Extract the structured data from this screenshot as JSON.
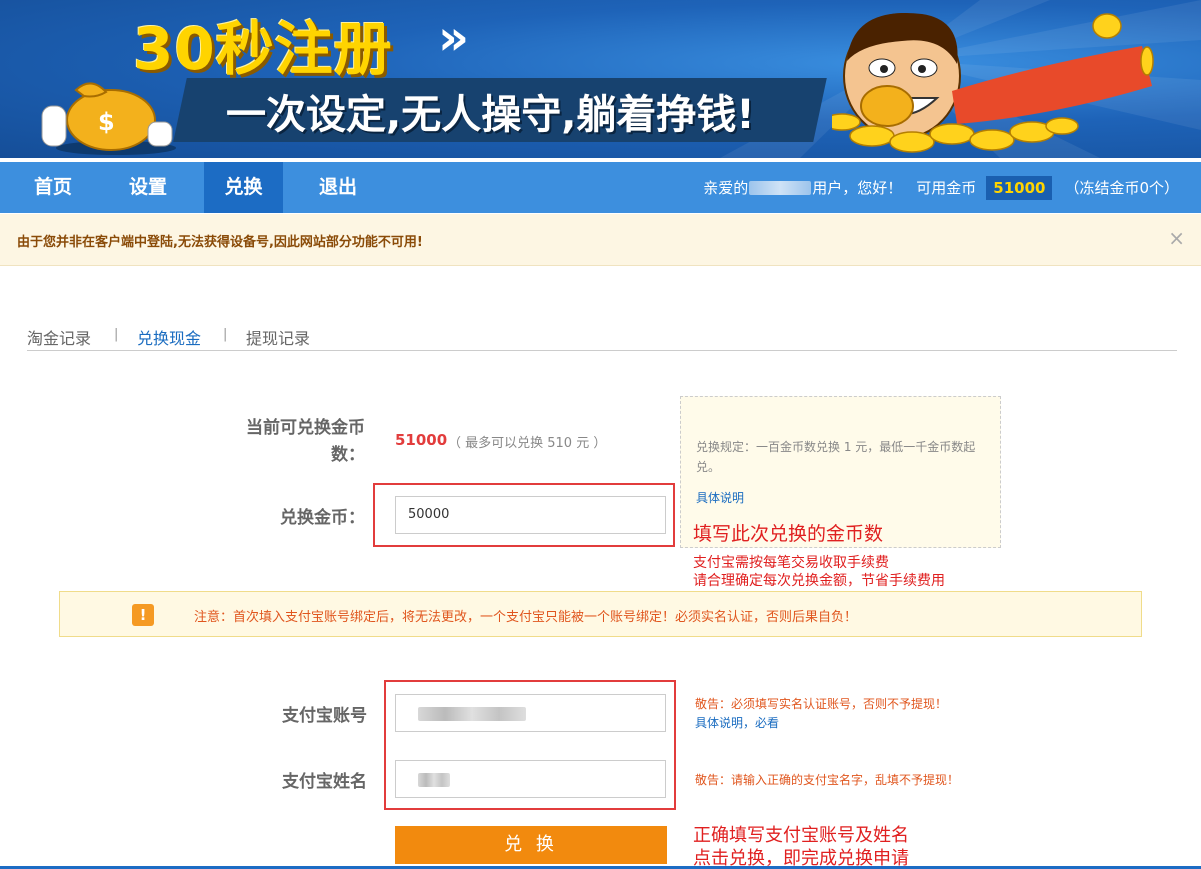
{
  "banner": {
    "title": "30秒注册",
    "chevron": "»",
    "subtitle": "一次设定,无人操守,躺着挣钱!"
  },
  "nav": {
    "items": [
      {
        "label": "首页"
      },
      {
        "label": "设置"
      },
      {
        "label": "兑换"
      },
      {
        "label": "退出"
      }
    ],
    "active": "兑换",
    "greeting_prefix": "亲爱的",
    "greeting_suffix": "用户，您好！",
    "available_label": "可用金币",
    "available_value": "51000",
    "frozen": "（冻结金币0个）"
  },
  "warning": {
    "text": "由于您并非在客户端中登陆,无法获得设备号,因此网站部分功能不可用!",
    "close": "×"
  },
  "tabs": [
    {
      "label": "淘金记录"
    },
    {
      "label": "兑换现金"
    },
    {
      "label": "提现记录"
    }
  ],
  "tab_separator": "|",
  "form": {
    "current_label_line1": "当前可兑换金币",
    "current_label_line2": "数：",
    "current_value": "51000",
    "current_note": "（ 最多可以兑换 510 元 ）",
    "coins_label": "兑换金币：",
    "coins_value": "50000",
    "alipay_account_label": "支付宝账号",
    "alipay_name_label": "支付宝姓名",
    "submit_label": "兑 换"
  },
  "rules": {
    "text": "兑换规定：一百金币数兑换 1 元，最低一千金币数起兑。",
    "link": "具体说明"
  },
  "notice": {
    "icon": "!",
    "text": "注意：首次填入支付宝账号绑定后，将无法更改，一个支付宝只能被一个账号绑定！必须实名认证，否则后果自负！"
  },
  "hints": {
    "account_warning": "敬告：必须填写实名认证账号，否则不予提现！",
    "account_link": "具体说明，必看",
    "name_warning": "敬告：请输入正确的支付宝名字，乱填不予提现！"
  },
  "annotations": {
    "a1": "填写此次兑换的金币数",
    "a2_line1": "支付宝需按每笔交易收取手续费",
    "a2_line2": "请合理确定每次兑换金额，节省手续费用",
    "a3_line1": "正确填写支付宝账号及姓名",
    "a3_line2": "点击兑换，即完成兑换申请"
  },
  "colors": {
    "nav": "#3d8fde",
    "nav_active": "#1c6cc4",
    "coin": "#ffd400",
    "submit": "#f28a0e",
    "annotation": "#e02020"
  }
}
